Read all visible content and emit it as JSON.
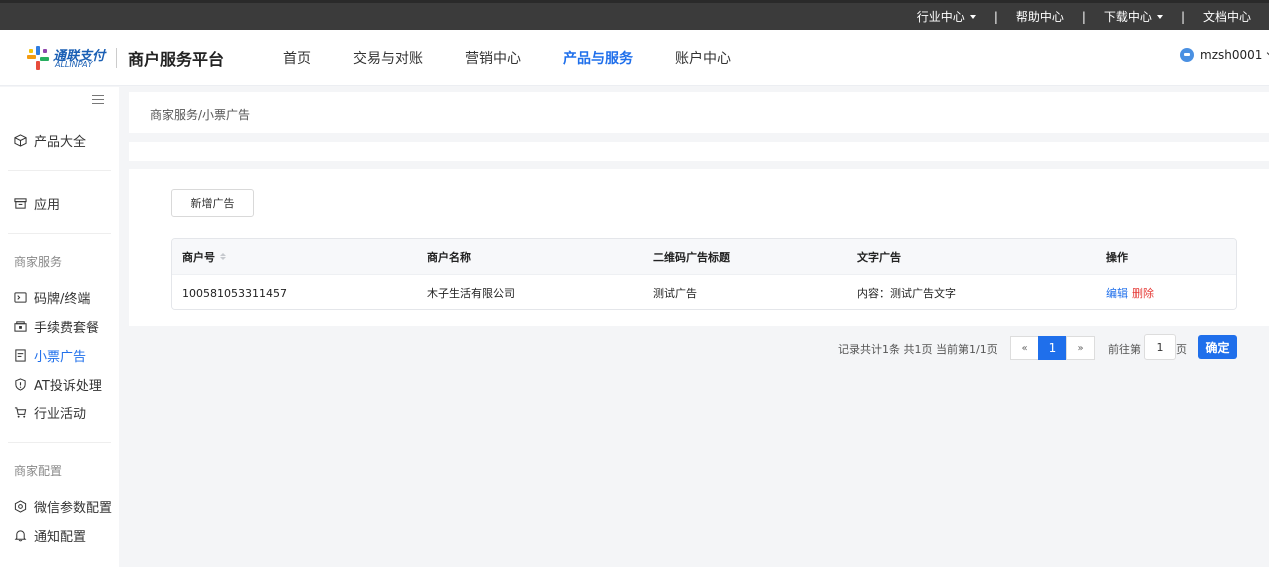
{
  "topbar": {
    "links": [
      {
        "label": "行业中心",
        "has_caret": true
      },
      {
        "label": "帮助中心",
        "has_caret": false
      },
      {
        "label": "下载中心",
        "has_caret": true
      },
      {
        "label": "文档中心",
        "has_caret": false
      }
    ],
    "separator": "|"
  },
  "header": {
    "logo": {
      "brand_cn": "通联支付",
      "brand_en": "ALLINPAY"
    },
    "platform_title": "商户服务平台",
    "nav": [
      {
        "label": "首页",
        "active": false
      },
      {
        "label": "交易与对账",
        "active": false
      },
      {
        "label": "营销中心",
        "active": false
      },
      {
        "label": "产品与服务",
        "active": true
      },
      {
        "label": "账户中心",
        "active": false
      }
    ],
    "user": {
      "name": "mzsh0001"
    }
  },
  "sidebar": {
    "product_all": {
      "label": "产品大全",
      "icon": "cube-icon"
    },
    "app": {
      "label": "应用",
      "icon": "archive-icon"
    },
    "section_merchant_service": "商家服务",
    "service_items": [
      {
        "label": "码牌/终端",
        "icon": "terminal-icon",
        "active": false
      },
      {
        "label": "手续费套餐",
        "icon": "package-icon",
        "active": false
      },
      {
        "label": "小票广告",
        "icon": "receipt-icon",
        "active": true
      },
      {
        "label": "AT投诉处理",
        "icon": "shield-icon",
        "active": false
      },
      {
        "label": "行业活动",
        "icon": "cart-icon",
        "active": false
      }
    ],
    "section_merchant_config": "商家配置",
    "config_items": [
      {
        "label": "微信参数配置",
        "icon": "hexagon-icon"
      },
      {
        "label": "通知配置",
        "icon": "bell-icon"
      }
    ]
  },
  "breadcrumb": "商家服务/小票广告",
  "toolbar": {
    "add_label": "新增广告"
  },
  "table": {
    "columns": [
      "商户号",
      "商户名称",
      "二维码广告标题",
      "文字广告",
      "操作"
    ],
    "rows": [
      {
        "merchant_id": "100581053311457",
        "merchant_name": "木子生活有限公司",
        "qr_ad_title": "测试广告",
        "text_ad": "内容：测试广告文字",
        "edit_label": "编辑",
        "delete_label": "删除"
      }
    ]
  },
  "pagination": {
    "summary": "记录共计1条 共1页 当前第1/1页",
    "prev": "«",
    "current": "1",
    "next": "»",
    "goto_label": "前往第",
    "goto_value": "1",
    "page_unit": "页",
    "confirm_label": "确定"
  },
  "colors": {
    "accent": "#1f6feb",
    "danger": "#e53935",
    "topbar": "#3b3b3b"
  }
}
